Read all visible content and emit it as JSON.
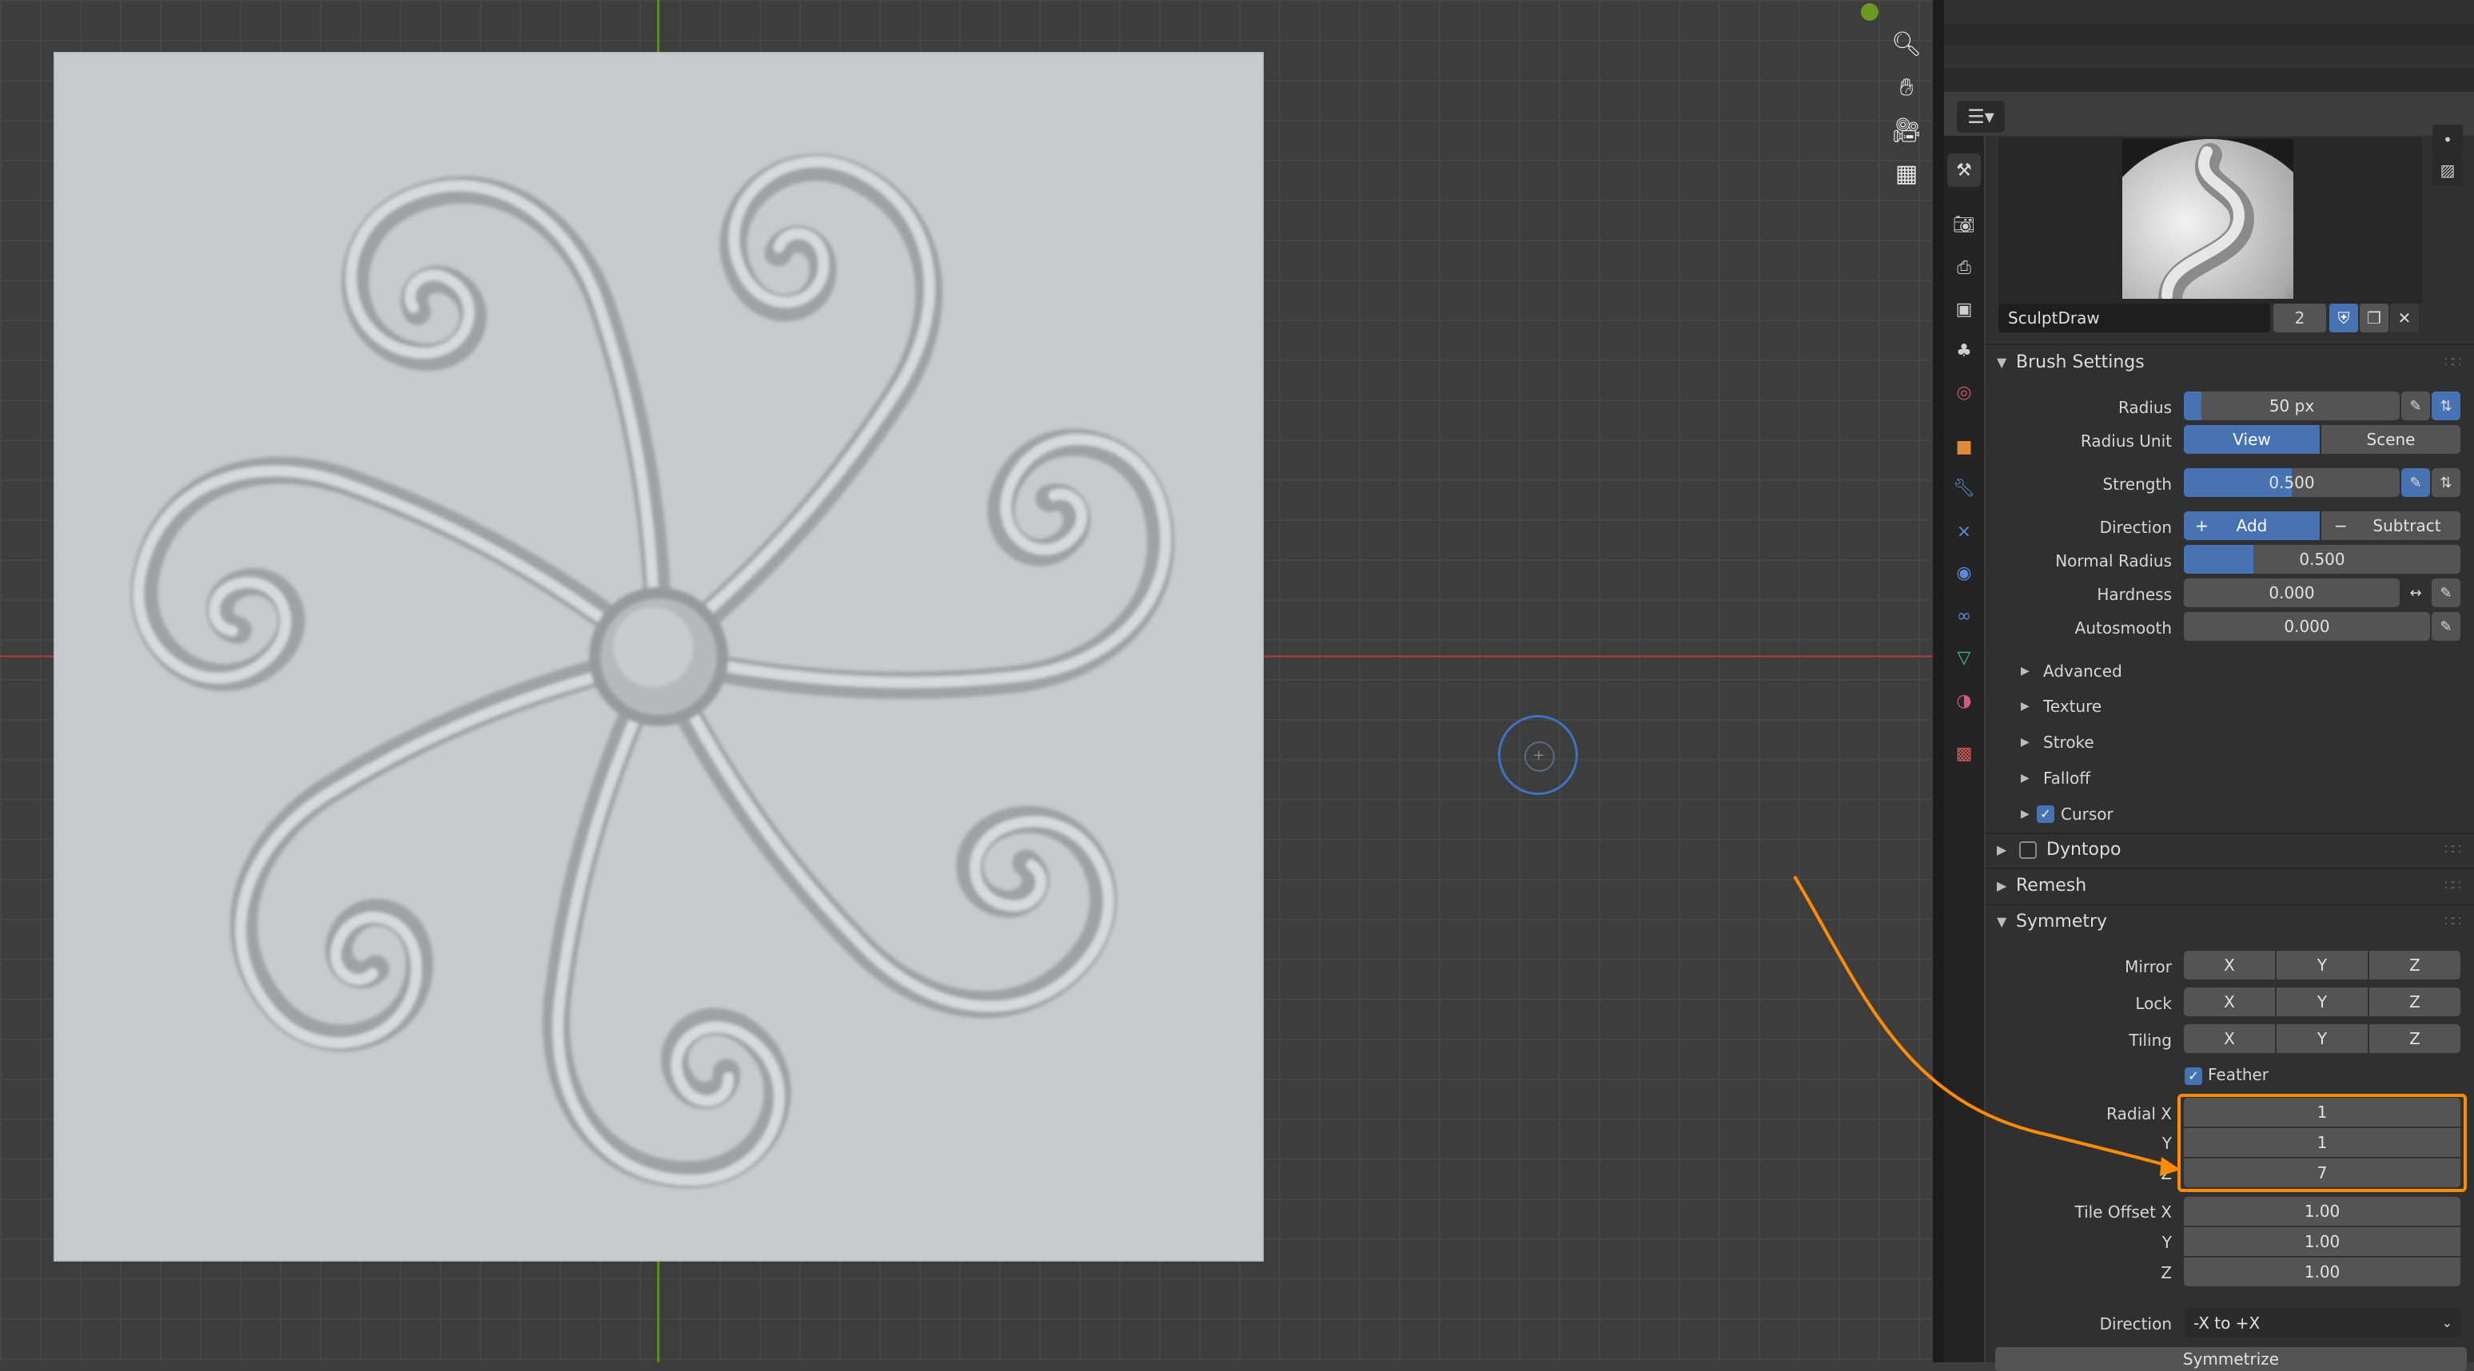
{
  "viewport": {
    "colors": {
      "x_axis": "#8f3c3c",
      "y_axis": "#5d8a25",
      "brush_ring": "#3c73c4",
      "annotation": "#ff8c00"
    },
    "gizmo_icons": [
      "zoom-icon",
      "pan-hand-icon",
      "camera-icon",
      "grid-icon"
    ]
  },
  "brush": {
    "name": "SculptDraw",
    "users": "2"
  },
  "brush_settings": {
    "title": "Brush Settings",
    "radius": {
      "label": "Radius",
      "value": "50 px",
      "fraction": 0.08
    },
    "radius_unit": {
      "label": "Radius Unit",
      "options": [
        "View",
        "Scene"
      ],
      "selected": "View"
    },
    "strength": {
      "label": "Strength",
      "value": "0.500",
      "fraction": 0.5
    },
    "direction": {
      "label": "Direction",
      "options": [
        "Add",
        "Subtract"
      ],
      "add_icon": "+",
      "sub_icon": "−",
      "selected": "Add"
    },
    "normal_radius": {
      "label": "Normal Radius",
      "value": "0.500",
      "fraction": 0.25
    },
    "hardness": {
      "label": "Hardness",
      "value": "0.000"
    },
    "autosmooth": {
      "label": "Autosmooth",
      "value": "0.000"
    },
    "subpanels": [
      "Advanced",
      "Texture",
      "Stroke",
      "Falloff",
      "Cursor"
    ]
  },
  "sections": {
    "dyntopo": "Dyntopo",
    "remesh": "Remesh",
    "symmetry": "Symmetry"
  },
  "symmetry": {
    "mirror": {
      "label": "Mirror",
      "x": "X",
      "y": "Y",
      "z": "Z"
    },
    "lock": {
      "label": "Lock",
      "x": "X",
      "y": "Y",
      "z": "Z"
    },
    "tiling": {
      "label": "Tiling",
      "x": "X",
      "y": "Y",
      "z": "Z"
    },
    "feather": "Feather",
    "radial": {
      "x_label": "Radial X",
      "y_label": "Y",
      "z_label": "Z",
      "x": "1",
      "y": "1",
      "z": "7"
    },
    "tile_offset": {
      "x_label": "Tile Offset X",
      "y_label": "Y",
      "z_label": "Z",
      "x": "1.00",
      "y": "1.00",
      "z": "1.00"
    },
    "direction": {
      "label": "Direction",
      "value": "-X to +X"
    },
    "symmetrize": "Symmetrize"
  }
}
